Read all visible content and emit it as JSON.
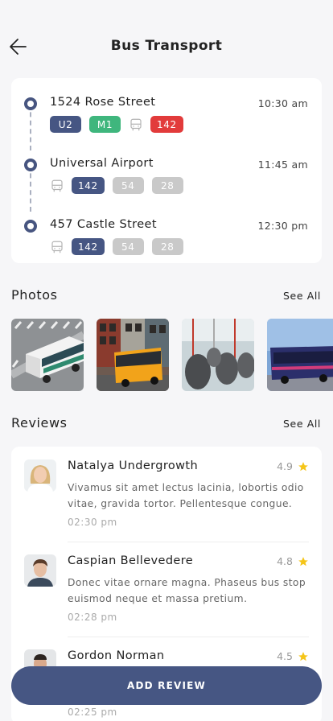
{
  "header": {
    "title": "Bus Transport",
    "back_icon": "arrow-left-icon"
  },
  "route": {
    "stops": [
      {
        "name": "1524 Rose Street",
        "time": "10:30 am",
        "lines": [
          {
            "type": "badge",
            "label": "U2",
            "color": "#465683"
          },
          {
            "type": "badge",
            "label": "M1",
            "color": "#3fb67d"
          },
          {
            "type": "icon",
            "icon": "bus-icon"
          },
          {
            "type": "badge",
            "label": "142",
            "color": "#e23b3b"
          }
        ]
      },
      {
        "name": "Universal Airport",
        "time": "11:45 am",
        "lines": [
          {
            "type": "icon",
            "icon": "bus-icon"
          },
          {
            "type": "badge",
            "label": "142",
            "color": "#465683"
          },
          {
            "type": "badge",
            "label": "54",
            "color": "#c9c9c9"
          },
          {
            "type": "badge",
            "label": "28",
            "color": "#c9c9c9"
          }
        ]
      },
      {
        "name": "457 Castle Street",
        "time": "12:30 pm",
        "lines": [
          {
            "type": "icon",
            "icon": "bus-icon"
          },
          {
            "type": "badge",
            "label": "142",
            "color": "#465683"
          },
          {
            "type": "badge",
            "label": "54",
            "color": "#c9c9c9"
          },
          {
            "type": "badge",
            "label": "28",
            "color": "#c9c9c9"
          }
        ]
      }
    ]
  },
  "photos": {
    "title": "Photos",
    "see_all": "See All",
    "items": [
      {
        "alt": "white-green-bus-photo"
      },
      {
        "alt": "yellow-bus-photo"
      },
      {
        "alt": "bus-interior-seats-photo"
      },
      {
        "alt": "blue-bus-photo"
      }
    ]
  },
  "reviews": {
    "title": "Reviews",
    "see_all": "See All",
    "items": [
      {
        "name": "Natalya Undergrowth",
        "rating": "4.9",
        "text": "Vivamus sit amet lectus lacinia, lobortis odio vitae, gravida tortor. Pellentesque congue.",
        "time": "02:30 pm"
      },
      {
        "name": "Caspian Bellevedere",
        "rating": "4.8",
        "text": "Donec vitae ornare magna. Phaseus bus stop euismod neque et massa pretium.",
        "time": "02:28 pm"
      },
      {
        "name": "Gordon Norman",
        "rating": "4.5",
        "text": "",
        "time": "02:25 pm"
      }
    ]
  },
  "actions": {
    "add_review": "ADD REVIEW"
  },
  "colors": {
    "accent": "#465683",
    "star": "#f5c518"
  }
}
